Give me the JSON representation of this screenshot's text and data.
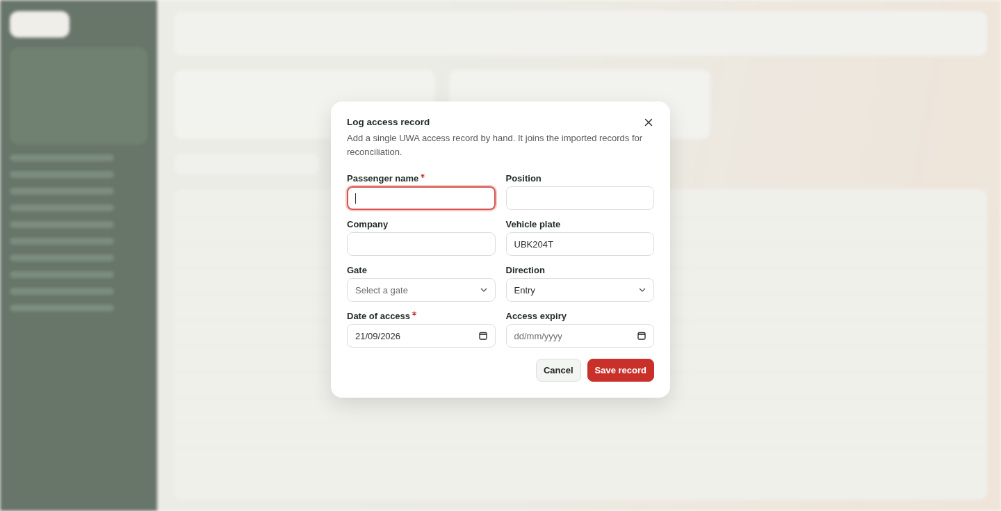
{
  "dialog": {
    "title": "Log access record",
    "description": "Add a single UWA access record by hand. It joins the imported records for reconciliation.",
    "fields": [
      {
        "kind": "text",
        "label": "Passenger name",
        "required": true,
        "focused": true
      },
      {
        "kind": "text",
        "label": "Position",
        "required": false,
        "focused": false
      },
      {
        "kind": "text",
        "label": "Company",
        "required": false,
        "focused": false
      },
      {
        "kind": "text",
        "label": "Vehicle plate",
        "required": false,
        "focused": false,
        "value": "UBK204T"
      },
      {
        "kind": "select",
        "label": "Gate",
        "required": false,
        "focused": false,
        "placeholder": "Select a gate"
      },
      {
        "kind": "select",
        "label": "Direction",
        "required": false,
        "focused": false,
        "value": "Entry"
      },
      {
        "kind": "date",
        "label": "Date of access",
        "required": true,
        "focused": false,
        "value": "21/09/2026"
      },
      {
        "kind": "date",
        "label": "Access expiry",
        "required": false,
        "focused": false,
        "placeholder": "dd/mm/yyyy"
      }
    ],
    "buttons": [
      {
        "kind": "secondary",
        "label": "Cancel"
      },
      {
        "kind": "primary",
        "label": "Save record"
      }
    ]
  }
}
